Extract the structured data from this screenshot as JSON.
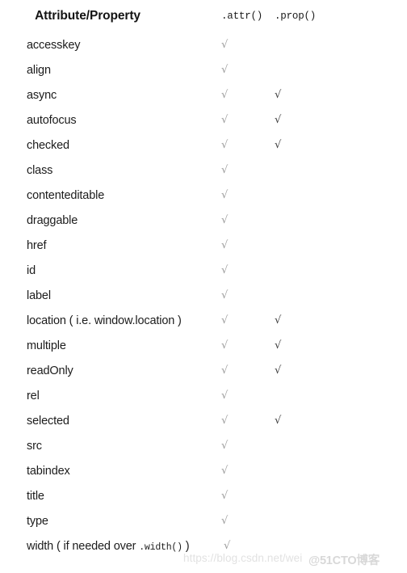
{
  "table": {
    "columns": {
      "name": "Attribute/Property",
      "attr": ".attr()",
      "prop": ".prop()"
    },
    "check_glyph": "√",
    "rows": [
      {
        "name": "accesskey",
        "name_mono": "",
        "name_tail": "",
        "attr": "√",
        "prop": ""
      },
      {
        "name": "align",
        "name_mono": "",
        "name_tail": "",
        "attr": "√",
        "prop": ""
      },
      {
        "name": "async",
        "name_mono": "",
        "name_tail": "",
        "attr": "√",
        "prop": "√"
      },
      {
        "name": "autofocus",
        "name_mono": "",
        "name_tail": "",
        "attr": "√",
        "prop": "√"
      },
      {
        "name": "checked",
        "name_mono": "",
        "name_tail": "",
        "attr": "√",
        "prop": "√"
      },
      {
        "name": "class",
        "name_mono": "",
        "name_tail": "",
        "attr": "√",
        "prop": ""
      },
      {
        "name": "contenteditable",
        "name_mono": "",
        "name_tail": "",
        "attr": "√",
        "prop": ""
      },
      {
        "name": "draggable",
        "name_mono": "",
        "name_tail": "",
        "attr": "√",
        "prop": ""
      },
      {
        "name": "href",
        "name_mono": "",
        "name_tail": "",
        "attr": "√",
        "prop": ""
      },
      {
        "name": "id",
        "name_mono": "",
        "name_tail": "",
        "attr": "√",
        "prop": ""
      },
      {
        "name": "label",
        "name_mono": "",
        "name_tail": "",
        "attr": "√",
        "prop": ""
      },
      {
        "name": "location ( i.e. window.location )",
        "name_mono": "",
        "name_tail": "",
        "attr": "√",
        "prop": "√"
      },
      {
        "name": "multiple",
        "name_mono": "",
        "name_tail": "",
        "attr": "√",
        "prop": "√"
      },
      {
        "name": "readOnly",
        "name_mono": "",
        "name_tail": "",
        "attr": "√",
        "prop": "√"
      },
      {
        "name": "rel",
        "name_mono": "",
        "name_tail": "",
        "attr": "√",
        "prop": ""
      },
      {
        "name": "selected",
        "name_mono": "",
        "name_tail": "",
        "attr": "√",
        "prop": "√"
      },
      {
        "name": "src",
        "name_mono": "",
        "name_tail": "",
        "attr": "√",
        "prop": ""
      },
      {
        "name": "tabindex",
        "name_mono": "",
        "name_tail": "",
        "attr": "√",
        "prop": ""
      },
      {
        "name": "title",
        "name_mono": "",
        "name_tail": "",
        "attr": "√",
        "prop": ""
      },
      {
        "name": "type",
        "name_mono": "",
        "name_tail": "",
        "attr": "√",
        "prop": ""
      },
      {
        "name": "width ( if needed over ",
        "name_mono": ".width()",
        "name_tail": " )",
        "attr": "√",
        "prop": ""
      }
    ]
  },
  "watermark": {
    "url": "https://blog.csdn.net/wei",
    "brand": "@51CTO博客"
  }
}
